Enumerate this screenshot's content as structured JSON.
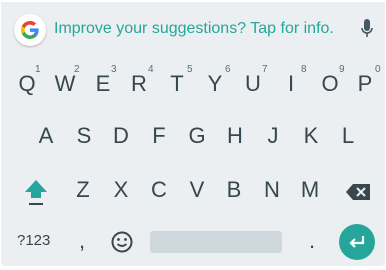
{
  "suggestion_strip": {
    "logo_icon": "google-g-icon",
    "hint_text": "Improve your suggestions? Tap for info.",
    "mic_icon": "microphone-icon",
    "hint_color": "#26a69a"
  },
  "rows": {
    "row1": [
      "Q",
      "W",
      "E",
      "R",
      "T",
      "Y",
      "U",
      "I",
      "O",
      "P"
    ],
    "row1_hints": [
      "1",
      "2",
      "3",
      "4",
      "5",
      "6",
      "7",
      "8",
      "9",
      "0"
    ],
    "row2": [
      "A",
      "S",
      "D",
      "F",
      "G",
      "H",
      "J",
      "K",
      "L"
    ],
    "row3": [
      "Z",
      "X",
      "C",
      "V",
      "B",
      "N",
      "M"
    ]
  },
  "bottom_row": {
    "symbols_label": "?123",
    "comma_label": ",",
    "period_label": ".",
    "emoji_icon": "emoji-icon",
    "enter_icon": "enter-icon"
  },
  "icons": {
    "shift": "shift-icon",
    "backspace": "backspace-icon"
  },
  "colors": {
    "accent": "#26a69a",
    "key_text": "#37474f",
    "background": "#eceff1"
  }
}
